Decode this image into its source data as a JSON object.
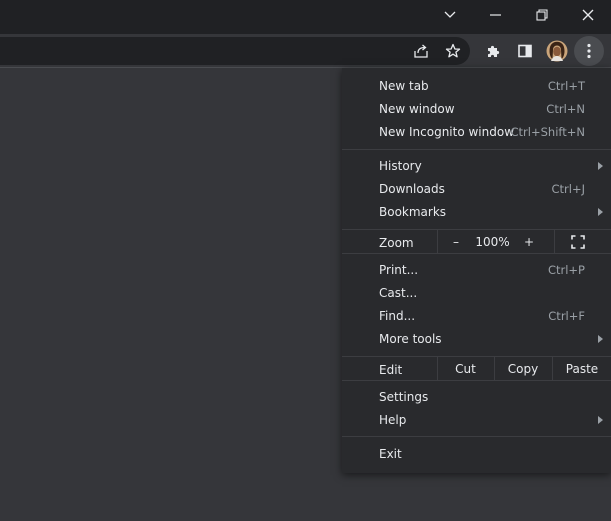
{
  "window_controls": {
    "tab_search_icon": "chevron-down-icon",
    "minimize_icon": "minimize-icon",
    "restore_icon": "restore-icon",
    "close_icon": "close-icon"
  },
  "toolbar": {
    "share_icon": "share-icon",
    "bookmark_icon": "star-icon",
    "extensions_icon": "puzzle-icon",
    "side_panel_icon": "side-panel-icon",
    "profile_icon": "avatar",
    "menu_icon": "kebab-menu-icon"
  },
  "menu": {
    "new_tab": {
      "label": "New tab",
      "shortcut": "Ctrl+T"
    },
    "new_window": {
      "label": "New window",
      "shortcut": "Ctrl+N"
    },
    "new_incognito": {
      "label": "New Incognito window",
      "shortcut": "Ctrl+Shift+N"
    },
    "history": {
      "label": "History"
    },
    "downloads": {
      "label": "Downloads",
      "shortcut": "Ctrl+J"
    },
    "bookmarks": {
      "label": "Bookmarks"
    },
    "zoom": {
      "label": "Zoom",
      "minus": "–",
      "value": "100%",
      "plus": "+"
    },
    "print": {
      "label": "Print...",
      "shortcut": "Ctrl+P"
    },
    "cast": {
      "label": "Cast..."
    },
    "find": {
      "label": "Find...",
      "shortcut": "Ctrl+F"
    },
    "more_tools": {
      "label": "More tools"
    },
    "edit": {
      "label": "Edit",
      "cut": "Cut",
      "copy": "Copy",
      "paste": "Paste"
    },
    "settings": {
      "label": "Settings"
    },
    "help": {
      "label": "Help"
    },
    "exit": {
      "label": "Exit"
    }
  },
  "colors": {
    "titlebar": "#202124",
    "toolbar": "#35363a",
    "menu_bg": "#292a2d",
    "text": "#e8eaed",
    "shortcut_text": "#9aa0a6"
  }
}
